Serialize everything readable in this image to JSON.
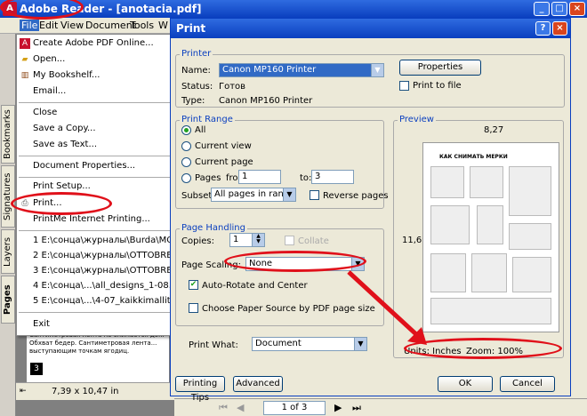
{
  "app": {
    "title": "Adobe Reader - [anotacia.pdf]",
    "icon": "adobe-reader-icon"
  },
  "menubar": [
    "File",
    "Edit",
    "View",
    "Document",
    "Tools",
    "W"
  ],
  "file_menu": {
    "items": [
      {
        "label": "Create Adobe PDF Online...",
        "icon": "pdf-online-icon"
      },
      {
        "label": "Open...",
        "icon": "folder-open-icon"
      },
      {
        "label": "My Bookshelf...",
        "icon": "bookshelf-icon"
      },
      {
        "label": "Email...",
        "icon": ""
      },
      {
        "label": "Close",
        "icon": ""
      },
      {
        "label": "Save a Copy...",
        "icon": ""
      },
      {
        "label": "Save as Text...",
        "icon": ""
      },
      {
        "label": "Document Properties...",
        "icon": ""
      },
      {
        "label": "Print Setup...",
        "icon": ""
      },
      {
        "label": "Print...",
        "icon": "printer-icon"
      },
      {
        "label": "PrintMe Internet Printing...",
        "icon": ""
      },
      {
        "label": "1 E:\\сонца\\журналы\\Burda\\МОИ СК",
        "icon": ""
      },
      {
        "label": "2 E:\\сонца\\журналы\\OTTOBRE\\200",
        "icon": ""
      },
      {
        "label": "3 E:\\сонца\\журналы\\OTTOBRE\\200",
        "icon": ""
      },
      {
        "label": "4 E:\\сонца\\...\\all_designs_1-08.pdf",
        "icon": ""
      },
      {
        "label": "5 E:\\сонца\\...\\4-07_kaikkimallit.pdf",
        "icon": ""
      },
      {
        "label": "Exit",
        "icon": ""
      }
    ]
  },
  "side_tabs": [
    "Bookmarks",
    "Signatures",
    "Layers",
    "Pages"
  ],
  "doc": {
    "text": "Сантиметровая лента не снимается до... Обхват бедер. Сантиметровая лента... выступающим точкам ягодиц.",
    "page_num": "3",
    "page_size": "7,39 x 10,47 in"
  },
  "bottom": {
    "page_indicator": "1 of 3"
  },
  "dialog": {
    "title": "Print",
    "printer": {
      "group": "Printer",
      "name_label": "Name:",
      "name_value": "Canon MP160 Printer",
      "status_label": "Status:",
      "status_value": "Готов",
      "type_label": "Type:",
      "type_value": "Canon MP160 Printer",
      "properties": "Properties",
      "print_to_file": "Print to file"
    },
    "range": {
      "group": "Print Range",
      "all": "All",
      "current_view": "Current view",
      "current_page": "Current page",
      "pages": "Pages",
      "from": "from:",
      "from_value": "1",
      "to": "to:",
      "to_value": "3",
      "subset_label": "Subset:",
      "subset_value": "All pages in range",
      "reverse": "Reverse pages"
    },
    "handling": {
      "group": "Page Handling",
      "copies_label": "Copies:",
      "copies_value": "1",
      "collate": "Collate",
      "scaling_label": "Page Scaling:",
      "scaling_value": "None",
      "auto_rotate": "Auto-Rotate and Center",
      "choose_source": "Choose Paper Source by PDF page size"
    },
    "print_what_label": "Print What:",
    "print_what_value": "Document",
    "preview": {
      "group": "Preview",
      "width": "8,27",
      "height": "11,69",
      "units": "Units: Inches",
      "zoom": "Zoom: 100%",
      "page_heading": "КАК СНИМАТЬ МЕРКИ"
    },
    "buttons": {
      "tips": "Printing Tips",
      "advanced": "Advanced",
      "ok": "OK",
      "cancel": "Cancel"
    }
  },
  "colors": {
    "highlight": "#e0101a",
    "titlebar": "#0a3fbf"
  }
}
